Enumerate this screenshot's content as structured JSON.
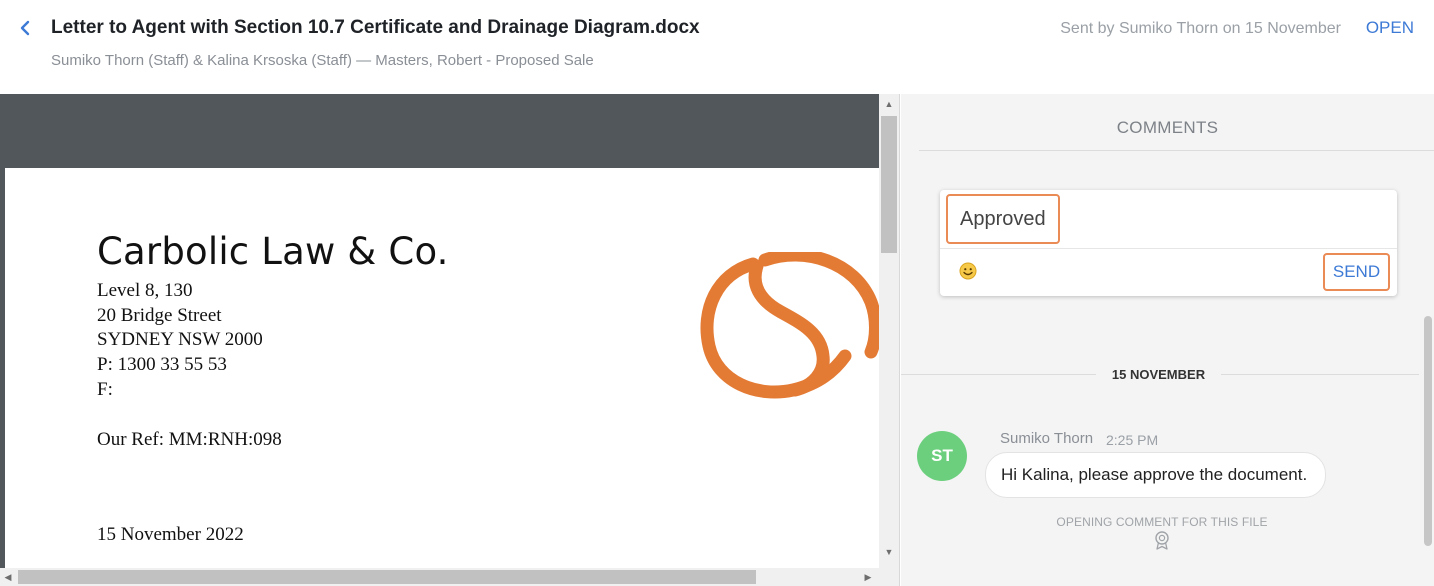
{
  "header": {
    "title": "Letter to Agent with Section 10.7 Certificate and Drainage Diagram.docx",
    "subtitle": "Sumiko Thorn (Staff) & Kalina Krsoska (Staff) — Masters, Robert - Proposed Sale",
    "sent_by": "Sent by Sumiko Thorn on 15 November",
    "open_label": "OPEN"
  },
  "document": {
    "firm_name": "Carbolic Law & Co.",
    "address_lines": [
      "Level 8, 130",
      "20 Bridge Street",
      "SYDNEY NSW 2000",
      "P: 1300 33 55 53",
      "F:"
    ],
    "our_ref": "Our Ref: MM:RNH:098",
    "date": "15 November 2022",
    "logo_color": "#e47b35"
  },
  "comments": {
    "title": "COMMENTS",
    "compose": {
      "value": "Approved",
      "emoji_icon": "smiley-icon",
      "send_label": "SEND"
    },
    "date_divider": "15 NOVEMBER",
    "items": [
      {
        "initials": "ST",
        "author": "Sumiko Thorn",
        "time": "2:25 PM",
        "text": "Hi Kalina, please approve the document.",
        "note": "OPENING COMMENT FOR THIS FILE",
        "note_icon": "award-icon",
        "avatar_color": "#6ccf7e"
      }
    ]
  },
  "colors": {
    "accent": "#3d7ad6",
    "highlight": "#ea8a55"
  }
}
